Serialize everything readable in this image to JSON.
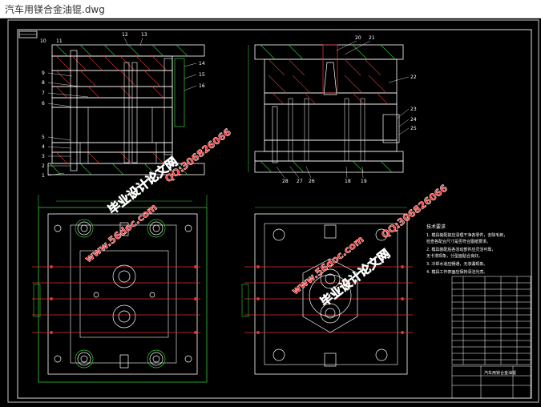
{
  "window": {
    "title": "汽车用镁合金油锟.dwg"
  },
  "drawing": {
    "labels_left": [
      "10",
      "11",
      "12",
      "13",
      "9",
      "8",
      "7",
      "6",
      "5",
      "4",
      "3",
      "2",
      "1",
      "14",
      "15",
      "16"
    ],
    "labels_right": [
      "20",
      "21",
      "22",
      "23",
      "24",
      "25",
      "28",
      "27",
      "26",
      "18",
      "19"
    ],
    "tech_heading": "技术要求",
    "tech_lines": [
      "1. 模具装配前应清理干净各零件，去除毛刺，",
      "   检查各配合尺寸是否符合图纸要求。",
      "2. 模具装配后各活动部件应灵活可靠，",
      "   无卡滞现象，分型面贴合良好。",
      "3. 冷却水道应畅通，无渗漏现象。",
      "4. 模具工作表面应保持清洁光亮。"
    ],
    "title_block_name": "汽车用镁合金油锟",
    "watermarks": {
      "brand": "毕业设计论文网",
      "site": "www.56doc.com",
      "qq": "QQ:306826066"
    }
  }
}
